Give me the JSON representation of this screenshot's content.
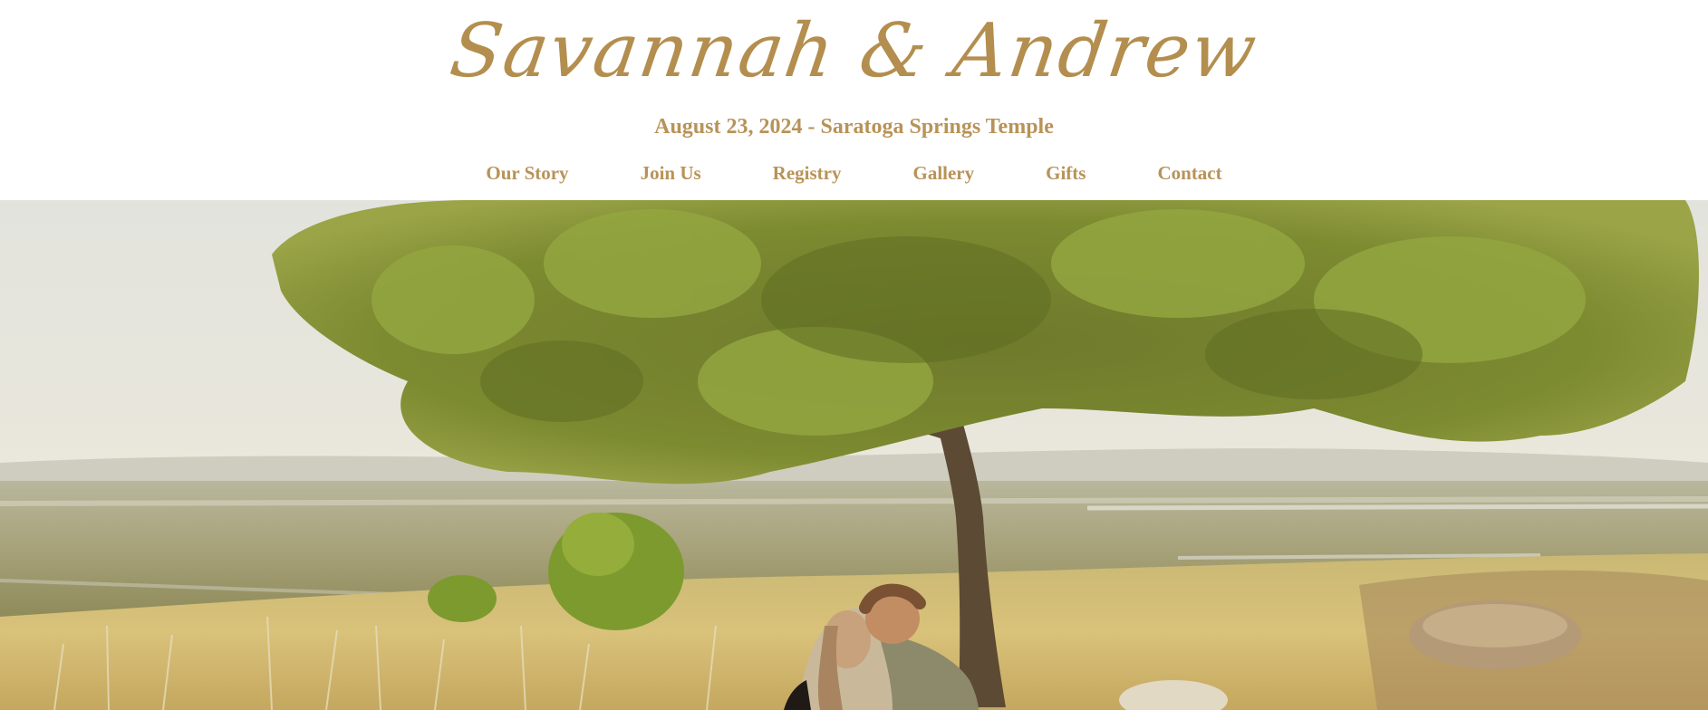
{
  "header": {
    "title": "Savannah & Andrew",
    "subtitle": "August 23, 2024 - Saratoga Springs Temple"
  },
  "nav": {
    "items": [
      {
        "label": "Our Story"
      },
      {
        "label": "Join Us"
      },
      {
        "label": "Registry"
      },
      {
        "label": "Gallery"
      },
      {
        "label": "Gifts"
      },
      {
        "label": "Contact"
      }
    ]
  },
  "colors": {
    "accent": "#b38e4e",
    "background": "#ffffff"
  },
  "hero": {
    "icon": "engagement-photo"
  }
}
